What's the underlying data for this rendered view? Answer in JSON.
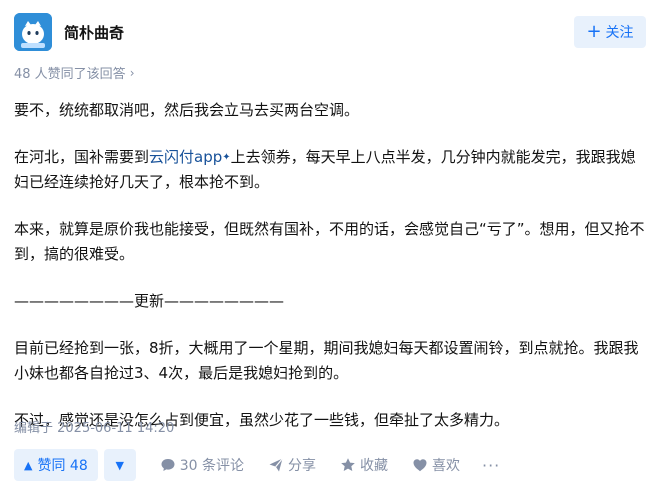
{
  "author": {
    "name": "简朴曲奇",
    "avatar_color": "#2f8ed8",
    "avatar_icon": "avatar-cartoon-icon"
  },
  "follow": {
    "label": "关注",
    "icon": "plus-icon"
  },
  "agree_line": {
    "text": "48 人赞同了该回答",
    "icon": "chevron-right-icon"
  },
  "content": {
    "p1": "要不，统统都取消吧，然后我会立马去买两台空调。",
    "p2_before": "在河北，国补需要到",
    "p2_link": "云闪付app",
    "p2_link_mark": "✦",
    "p2_after": "上去领券，每天早上八点半发，几分钟内就能发完，我跟我媳妇已经连续抢好几天了，根本抢不到。",
    "p3": "本来，就算是原价我也能接受，但既然有国补，不用的话，会感觉自己“亏了”。想用，但又抢不到，搞的很难受。",
    "divider": "————————更新————————",
    "p4": "目前已经抢到一张，8折，大概用了一个星期，期间我媳妇每天都设置闹铃，到点就抢。我跟我小妹也都各自抢过3、4次，最后是我媳妇抢到的。",
    "p5": "不过，感觉还是没怎么占到便宜，虽然少花了一些钱，但牵扯了太多精力。"
  },
  "edited": "编辑于 2025-06-11 14:20",
  "actions": {
    "vote_up": "赞同 48",
    "comments": "30 条评论",
    "share": "分享",
    "favorite": "收藏",
    "like": "喜欢",
    "more": "···"
  },
  "colors": {
    "accent": "#1772f6",
    "accent_bg": "#e8f1fc",
    "muted": "#8590a6",
    "link": "#175199"
  }
}
